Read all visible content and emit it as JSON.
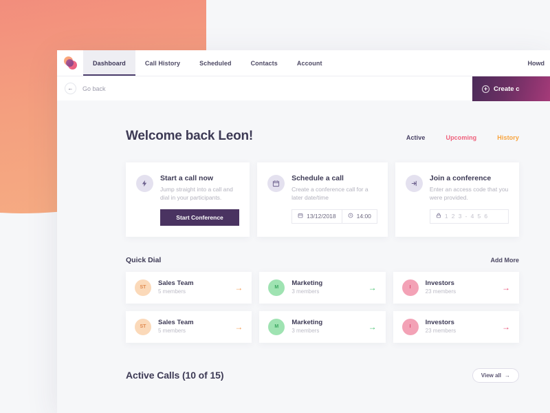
{
  "brand": {
    "logo_name": "overlapping-circles-logo"
  },
  "nav": {
    "tabs": [
      {
        "label": "Dashboard",
        "active": true
      },
      {
        "label": "Call History",
        "active": false
      },
      {
        "label": "Scheduled",
        "active": false
      },
      {
        "label": "Contacts",
        "active": false
      },
      {
        "label": "Account",
        "active": false
      }
    ],
    "greeting": "Howd"
  },
  "subbar": {
    "back_label": "Go back",
    "back_icon": "arrow-left-icon",
    "create_label": "Create c",
    "create_icon": "plus-circle-icon"
  },
  "main": {
    "welcome_title": "Welcome back Leon!",
    "filters": [
      {
        "label": "Active",
        "color": "#463f63"
      },
      {
        "label": "Upcoming",
        "color": "#ef5f7b"
      },
      {
        "label": "History",
        "color": "#f8a33c"
      }
    ],
    "cards": [
      {
        "icon": "lightning-bolt-icon",
        "title": "Start a call now",
        "desc": "Jump straight into a call and dial in your participants.",
        "button_label": "Start Conference"
      },
      {
        "icon": "calendar-icon",
        "title": "Schedule a call",
        "desc": "Create a conference call for a later date/time",
        "date_value": "13/12/2018",
        "time_value": "14:00",
        "date_icon": "calendar-icon",
        "time_icon": "clock-icon"
      },
      {
        "icon": "enter-door-icon",
        "title": "Join a conference",
        "desc": "Enter an access code that you were provided.",
        "code_placeholder": "1 2 3 - 4 5 6",
        "code_icon": "lock-icon"
      }
    ],
    "quick_dial": {
      "title": "Quick Dial",
      "action_label": "Add More",
      "items": [
        {
          "initials": "ST",
          "name": "Sales Team",
          "members": "5 members",
          "color": "#f8b98a",
          "bg": "#fbd9b9",
          "text": "#e08a4f"
        },
        {
          "initials": "M",
          "name": "Marketing",
          "members": "3 members",
          "color": "#7fd99b",
          "bg": "#9fe3b2",
          "text": "#3da862"
        },
        {
          "initials": "I",
          "name": "Investors",
          "members": "23 members",
          "color": "#f08fa8",
          "bg": "#f3a2b6",
          "text": "#d8496f"
        },
        {
          "initials": "ST",
          "name": "Sales Team",
          "members": "5 members",
          "color": "#f8b98a",
          "bg": "#fbd9b9",
          "text": "#e08a4f"
        },
        {
          "initials": "M",
          "name": "Marketing",
          "members": "3 members",
          "color": "#7fd99b",
          "bg": "#9fe3b2",
          "text": "#3da862"
        },
        {
          "initials": "I",
          "name": "Investors",
          "members": "23 members",
          "color": "#f08fa8",
          "bg": "#f3a2b6",
          "text": "#d8496f"
        }
      ],
      "arrow_colors": [
        "#f59a4e",
        "#3fc06a",
        "#e8476f",
        "#f59a4e",
        "#3fc06a",
        "#e8476f"
      ]
    },
    "active_calls": {
      "title": "Active Calls (10 of 15)",
      "view_all_label": "View all",
      "view_all_icon": "arrow-right-icon"
    }
  }
}
